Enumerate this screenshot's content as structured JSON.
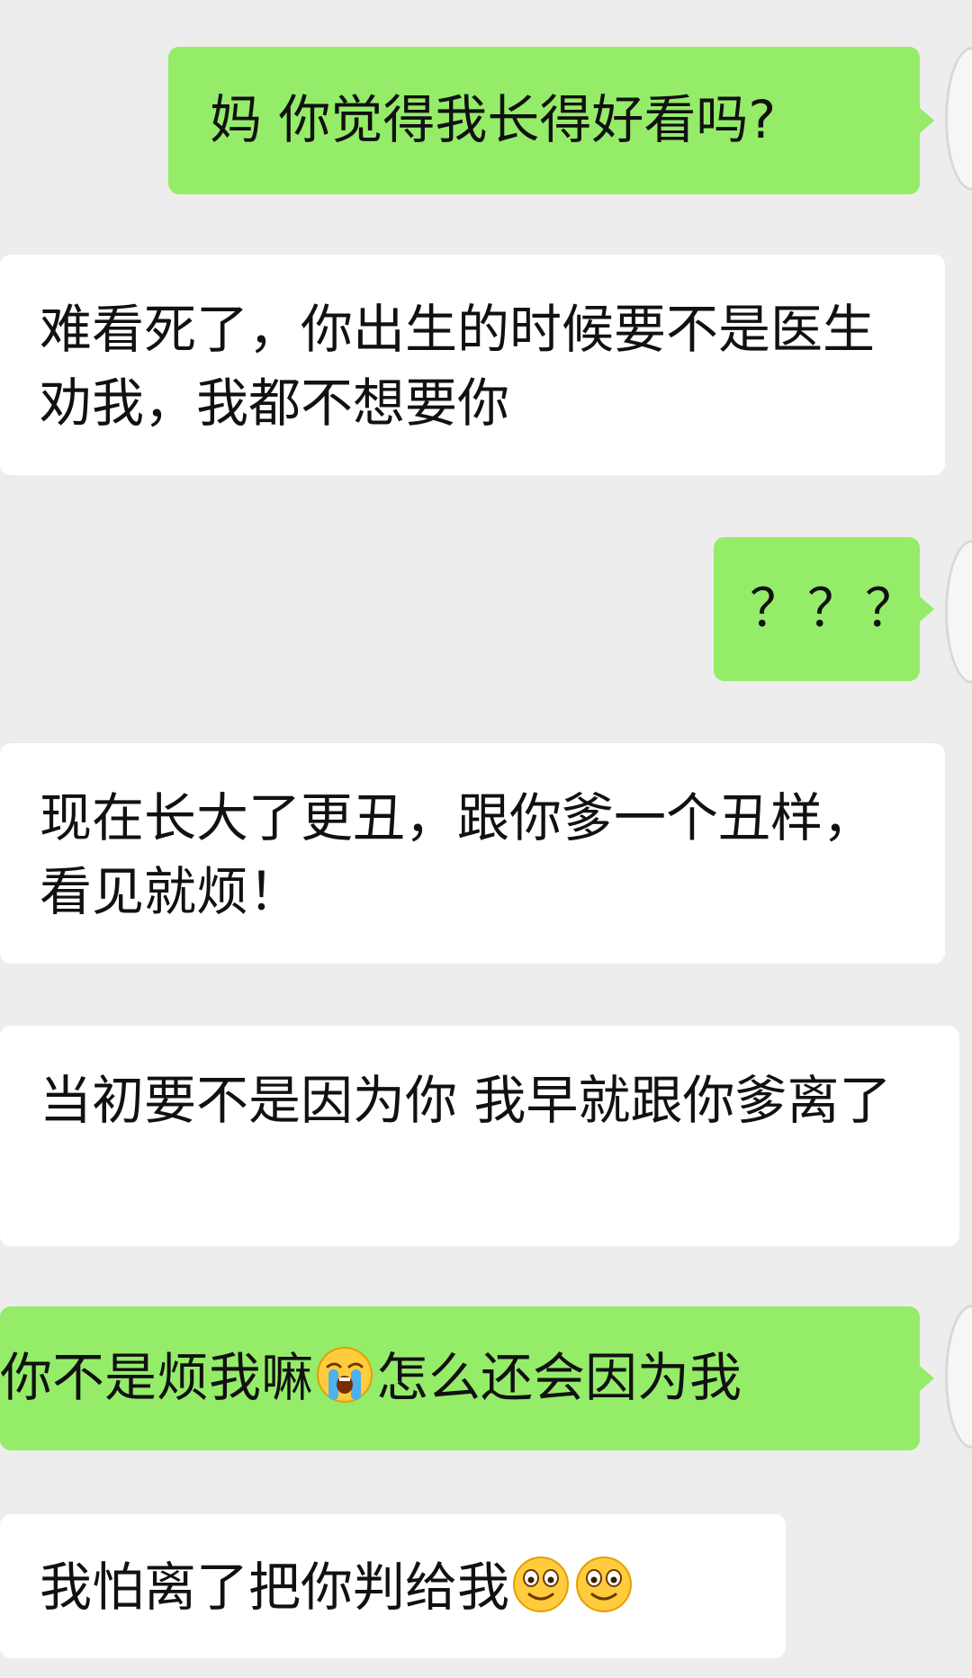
{
  "colors": {
    "background": "#ededed",
    "sent_bubble": "#95ec69",
    "received_bubble": "#ffffff",
    "text": "#111111"
  },
  "messages": [
    {
      "side": "sent",
      "text": "妈 你觉得我长得好看吗?"
    },
    {
      "side": "received",
      "text": "难看死了，你出生的时候要不是医生劝我，我都不想要你"
    },
    {
      "side": "sent",
      "text": "？？？"
    },
    {
      "side": "received",
      "text": "现在长大了更丑，跟你爹一个丑样，看见就烦！"
    },
    {
      "side": "received",
      "text": "当初要不是因为你 我早就跟你爹离了"
    },
    {
      "side": "sent",
      "text_before": "你不是烦我嘛",
      "emoji": "loudly-crying-face-icon",
      "text_after": "怎么还会因为我"
    },
    {
      "side": "received",
      "text": "我怕离了把你判给我",
      "emojis": [
        "smiling-face-icon",
        "smiling-face-icon"
      ]
    }
  ]
}
